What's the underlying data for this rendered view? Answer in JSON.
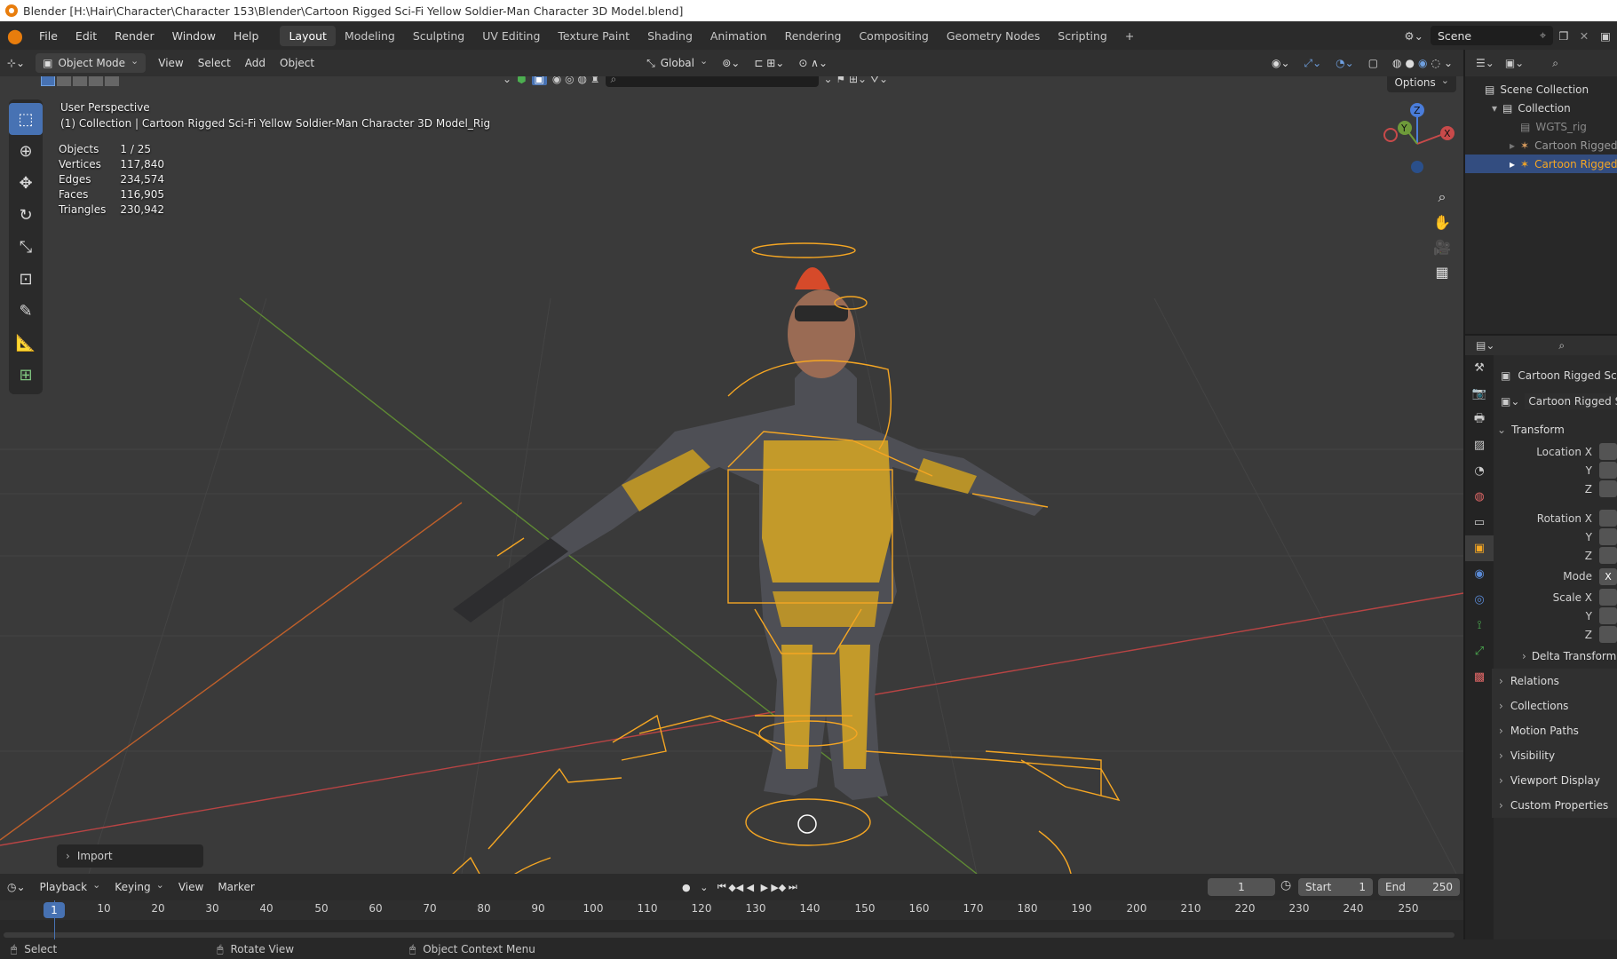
{
  "title": "Blender [H:\\Hair\\Character\\Character 153\\Blender\\Cartoon Rigged Sci-Fi Yellow Soldier-Man Character 3D Model.blend]",
  "menu": [
    "File",
    "Edit",
    "Render",
    "Window",
    "Help"
  ],
  "workspaces": [
    "Layout",
    "Modeling",
    "Sculpting",
    "UV Editing",
    "Texture Paint",
    "Shading",
    "Animation",
    "Rendering",
    "Compositing",
    "Geometry Nodes",
    "Scripting"
  ],
  "active_workspace": "Layout",
  "add_tab": "+",
  "scene": "Scene",
  "header": {
    "mode": "Object Mode",
    "view": "View",
    "select": "Select",
    "add": "Add",
    "object": "Object",
    "orientation": "Global",
    "options": "Options"
  },
  "overlay": {
    "perspective": "User Perspective",
    "object_path": "(1) Collection | Cartoon Rigged Sci-Fi Yellow Soldier-Man Character 3D Model_Rig",
    "stats": [
      {
        "label": "Objects",
        "value": "1 / 25"
      },
      {
        "label": "Vertices",
        "value": "117,840"
      },
      {
        "label": "Edges",
        "value": "234,574"
      },
      {
        "label": "Faces",
        "value": "116,905"
      },
      {
        "label": "Triangles",
        "value": "230,942"
      }
    ]
  },
  "gizmo": {
    "z": "Z",
    "y": "Y",
    "x": "X"
  },
  "import_panel": "Import",
  "outliner": {
    "scene_collection": "Scene Collection",
    "collection": "Collection",
    "items": [
      "WGTS_rig",
      "Cartoon Rigged",
      "Cartoon Rigged"
    ]
  },
  "properties": {
    "object_name": "Cartoon Rigged Sci-F",
    "data_name": "Cartoon Rigged Sc",
    "transform": "Transform",
    "location": [
      "Location X",
      "Y",
      "Z"
    ],
    "rotation": [
      "Rotation X",
      "Y",
      "Z"
    ],
    "mode_label": "Mode",
    "mode_value": "X",
    "scale": [
      "Scale X",
      "Y",
      "Z"
    ],
    "delta_transform": "Delta Transform",
    "sections": [
      "Relations",
      "Collections",
      "Motion Paths",
      "Visibility",
      "Viewport Display",
      "Custom Properties"
    ]
  },
  "timeline": {
    "playback": "Playback",
    "keying": "Keying",
    "view": "View",
    "marker": "Marker",
    "current_frame": "1",
    "start_label": "Start",
    "start": "1",
    "end_label": "End",
    "end": "250",
    "ruler": [
      "10",
      "20",
      "30",
      "40",
      "50",
      "60",
      "70",
      "80",
      "90",
      "100",
      "110",
      "120",
      "130",
      "140",
      "150",
      "160",
      "170",
      "180",
      "190",
      "200",
      "210",
      "220",
      "230",
      "240",
      "250"
    ],
    "playhead": "1"
  },
  "status": {
    "select": "Select",
    "rotate": "Rotate View",
    "context": "Object Context Menu"
  },
  "colors": {
    "accent": "#4772b3",
    "selection": "#f5a623",
    "x_axis": "#c84a4a",
    "y_axis": "#6e9a3a"
  }
}
